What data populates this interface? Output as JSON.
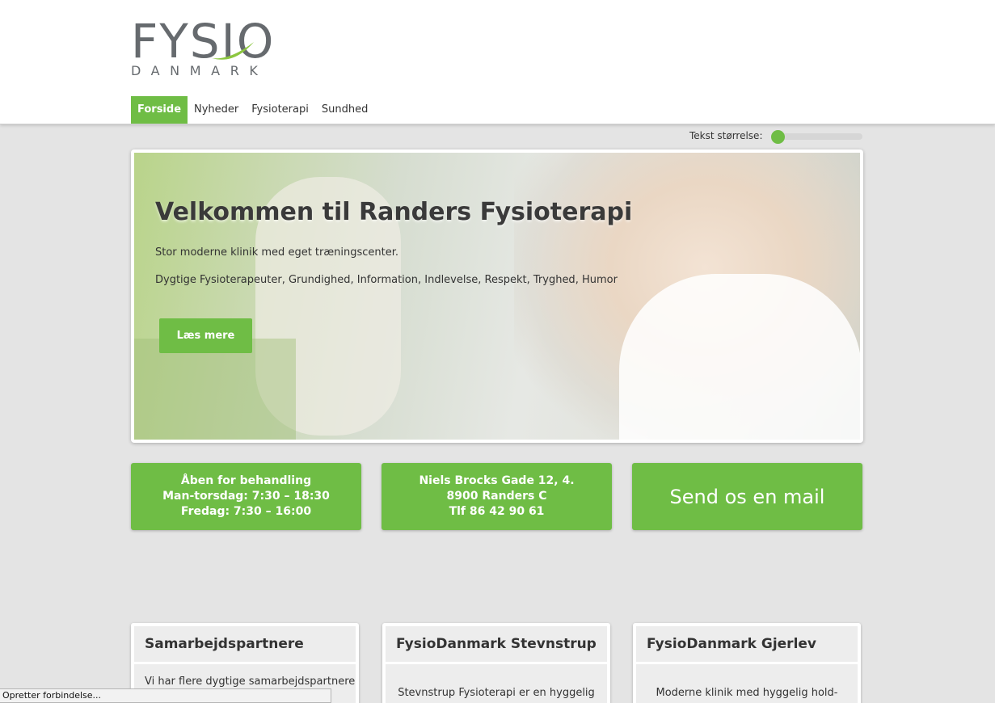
{
  "brand": {
    "logo_word": "FYSIO",
    "logo_sub": "DANMARK",
    "accent_color": "#6fbd45"
  },
  "nav": [
    {
      "label": "Forside",
      "active": true
    },
    {
      "label": "Nyheder",
      "active": false
    },
    {
      "label": "Fysioterapi",
      "active": false
    },
    {
      "label": "Sundhed",
      "active": false
    }
  ],
  "text_size": {
    "label": "Tekst størrelse:",
    "level": 0
  },
  "hero": {
    "title": "Velkommen til Randers Fysioterapi",
    "line1": "Stor moderne klinik med eget træningscenter.",
    "line2": "Dygtige Fysioterapeuter, Grundighed, Information, Indlevelse, Respekt, Tryghed, Humor",
    "button": "Læs mere"
  },
  "tiles": {
    "hours": {
      "l1": "Åben for behandling",
      "l2": "Man-torsdag: 7:30 – 18:30",
      "l3": "Fredag: 7:30 – 16:00"
    },
    "address": {
      "l1": "Niels Brocks Gade 12, 4.",
      "l2": "8900 Randers C",
      "l3": "Tlf 86 42 90 61"
    },
    "mail": {
      "label": "Send os en mail"
    }
  },
  "cards": [
    {
      "title": "Samarbejdspartnere",
      "body": "Vi har flere dygtige samarbejdspartnere"
    },
    {
      "title": "FysioDanmark Stevnstrup",
      "body": "Stevnstrup Fysioterapi er en hyggelig"
    },
    {
      "title": "FysioDanmark Gjerlev",
      "body": "Moderne klinik med hyggelig hold-"
    }
  ],
  "status": "Opretter forbindelse..."
}
